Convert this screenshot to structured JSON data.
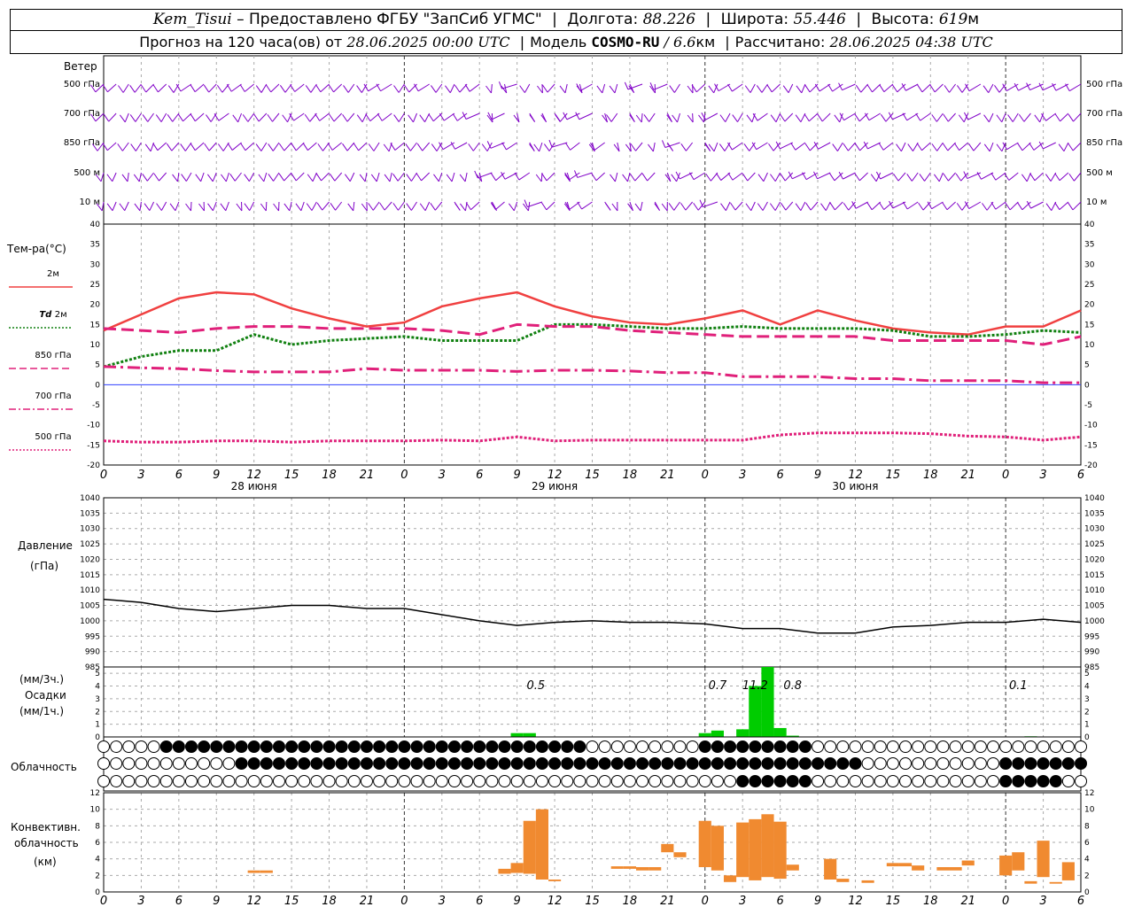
{
  "header": {
    "station": "Kem_Tisui",
    "provider": "Предоставлено ФГБУ \"ЗапСиб УГМС\"",
    "lon_label": "Долгота:",
    "lon": "88.226",
    "lat_label": "Широта:",
    "lat": "55.446",
    "alt_label": "Высота:",
    "alt": "619",
    "alt_unit": "м",
    "forecast_prefix": "Прогноз на 120 часа(ов) от",
    "forecast_start": "28.06.2025 00:00 UTC",
    "model_label": "Модель",
    "model": "COSMO-RU",
    "resolution": "6.6",
    "resolution_unit": "км",
    "computed_label": "Рассчитано:",
    "computed": "28.06.2025 04:38 UTC"
  },
  "time_axis": {
    "hours": [
      "0",
      "3",
      "6",
      "9",
      "12",
      "15",
      "18",
      "21",
      "0",
      "3",
      "6",
      "9",
      "12",
      "15",
      "18",
      "21",
      "0",
      "3",
      "6",
      "9",
      "12",
      "15",
      "18",
      "21",
      "0",
      "3",
      "6"
    ],
    "days": [
      {
        "label": "28 июня",
        "hour_index": 12
      },
      {
        "label": "29 июня",
        "hour_index": 36
      },
      {
        "label": "30 июня",
        "hour_index": 60
      }
    ]
  },
  "wind_panel": {
    "title": "Ветер",
    "levels": [
      "500 гПа",
      "700 гПа",
      "850 гПа",
      "500 м",
      "10 м"
    ],
    "color": "#8000c8"
  },
  "temp_panel": {
    "title": "Тем-ра(°С)",
    "legend": [
      {
        "label": "2м",
        "color": "#f04040",
        "style": "solid"
      },
      {
        "label_italic": "Td",
        "label": "2м",
        "color": "#108010",
        "style": "dotted"
      },
      {
        "label": "850 гПа",
        "color": "#e0207a",
        "style": "dashed"
      },
      {
        "label": "700 гПа",
        "color": "#e0207a",
        "style": "dashdot"
      },
      {
        "label": "500 гПа",
        "color": "#e0207a",
        "style": "dotted"
      }
    ],
    "ticks": [
      "40",
      "35",
      "30",
      "25",
      "20",
      "15",
      "10",
      "5",
      "0",
      "-5",
      "-10",
      "-15",
      "-20"
    ]
  },
  "pressure_panel": {
    "title1": "Давление",
    "title2": "(гПа)",
    "ticks": [
      "1040",
      "1035",
      "1030",
      "1025",
      "1020",
      "1015",
      "1010",
      "1005",
      "1000",
      "995",
      "990",
      "985"
    ]
  },
  "precip_panel": {
    "title1": "(мм/3ч.)",
    "title2": "Осадки",
    "title3": "(мм/1ч.)",
    "ticks": [
      "5",
      "4",
      "3",
      "2",
      "1",
      "0"
    ],
    "totals": [
      {
        "hour": 34.5,
        "label": "0.5"
      },
      {
        "hour": 49,
        "label": "0.7"
      },
      {
        "hour": 52,
        "label": "11.2"
      },
      {
        "hour": 55,
        "label": "0.8"
      },
      {
        "hour": 73,
        "label": "0.1"
      }
    ]
  },
  "cloud_panel": {
    "title": "Облачность"
  },
  "conv_panel": {
    "title1": "Конвективн.",
    "title2": "облачность",
    "title3": "(км)",
    "ticks": [
      "12",
      "10",
      "8",
      "6",
      "4",
      "2",
      "0"
    ]
  },
  "chart_data": [
    {
      "type": "line",
      "title": "Тем-ра(°С)",
      "xlabel": "",
      "ylabel": "Тем-ра(°С)",
      "x_hours_from_start": [
        0,
        3,
        6,
        9,
        12,
        15,
        18,
        21,
        24,
        27,
        30,
        33,
        36,
        39,
        42,
        45,
        48,
        51,
        54,
        57,
        60,
        63,
        66,
        69,
        72,
        75,
        78
      ],
      "ylim": [
        -20,
        40
      ],
      "series": [
        {
          "name": "2м",
          "color": "#f04040",
          "dash": "solid",
          "values": [
            13.5,
            17.5,
            21.5,
            23,
            22.5,
            19,
            16.5,
            14.5,
            15.5,
            19.5,
            21.5,
            23,
            19.5,
            17,
            15.5,
            15,
            16.5,
            18.5,
            15,
            18.5,
            16,
            14,
            13,
            12.5,
            14.5,
            14.5,
            18.5
          ]
        },
        {
          "name": "Td 2м",
          "color": "#108010",
          "dash": "dotted",
          "values": [
            4.5,
            7,
            8.5,
            8.5,
            12.5,
            10,
            11,
            11.5,
            12,
            11,
            11,
            11,
            15,
            15,
            14.5,
            14,
            14,
            14.5,
            14,
            14,
            14,
            13.5,
            12,
            12,
            12.5,
            13.5,
            13
          ]
        },
        {
          "name": "850 гПа",
          "color": "#e0207a",
          "dash": "dashed",
          "values": [
            14,
            13.5,
            13,
            14,
            14.5,
            14.5,
            14,
            14,
            14,
            13.5,
            12.5,
            15,
            14.5,
            14.5,
            13.5,
            13,
            12.5,
            12,
            12,
            12,
            12,
            11,
            11,
            11,
            11,
            10,
            12
          ]
        },
        {
          "name": "700 гПа",
          "color": "#e0207a",
          "dash": "dashdot",
          "values": [
            4.5,
            4.2,
            4,
            3.5,
            3.2,
            3.2,
            3.2,
            4,
            3.6,
            3.6,
            3.6,
            3.3,
            3.6,
            3.6,
            3.4,
            3,
            3,
            2,
            2,
            2,
            1.5,
            1.5,
            1,
            1,
            1,
            0.5,
            0.5
          ]
        },
        {
          "name": "500 гПа",
          "color": "#e0207a",
          "dash": "dotted",
          "values": [
            -14,
            -14.3,
            -14.3,
            -14,
            -14,
            -14.3,
            -14,
            -14,
            -14,
            -13.8,
            -14,
            -13,
            -14,
            -13.8,
            -13.8,
            -13.8,
            -13.8,
            -13.8,
            -12.5,
            -12,
            -12,
            -12,
            -12.2,
            -12.8,
            -13,
            -13.8,
            -13
          ]
        }
      ]
    },
    {
      "type": "line",
      "title": "Давление (гПа)",
      "xlabel": "",
      "ylabel": "Давление (гПа)",
      "x_hours_from_start": [
        0,
        3,
        6,
        9,
        12,
        15,
        18,
        21,
        24,
        27,
        30,
        33,
        36,
        39,
        42,
        45,
        48,
        51,
        54,
        57,
        60,
        63,
        66,
        69,
        72,
        75,
        78
      ],
      "ylim": [
        985,
        1040
      ],
      "series": [
        {
          "name": "",
          "color": "#000000",
          "dash": "solid",
          "values": [
            1007,
            1006,
            1004,
            1003,
            1004,
            1005,
            1005,
            1004,
            1004,
            1002,
            1000,
            998.5,
            999.5,
            1000,
            999.5,
            999.5,
            999,
            997.5,
            997.5,
            996,
            996,
            998,
            998.5,
            999.5,
            999.5,
            1000.5,
            999.5
          ]
        }
      ]
    },
    {
      "type": "bar",
      "title": "Осадки",
      "xlabel": "",
      "ylabel": "мм/1ч.",
      "x_hours_from_start": [
        33,
        34,
        48,
        49,
        51,
        52,
        53,
        54,
        55,
        74
      ],
      "ylim": [
        0,
        5.5
      ],
      "series": [
        {
          "name": "",
          "color": "#00cc00",
          "values": [
            0.3,
            0.3,
            0.3,
            0.5,
            0.6,
            4.0,
            5.5,
            0.7,
            0.1,
            0.05
          ]
        }
      ]
    },
    {
      "type": "bar",
      "title": "Конвективн. облачность (км)",
      "xlabel": "",
      "ylabel": "км",
      "ylim": [
        0,
        12
      ],
      "series": [
        {
          "name": "",
          "color": "#f08a30",
          "ranges_km": [
            {
              "hour": 12,
              "bottom": 2.3,
              "top": 2.6
            },
            {
              "hour": 13,
              "bottom": 2.3,
              "top": 2.6
            },
            {
              "hour": 32,
              "bottom": 2.2,
              "top": 2.8
            },
            {
              "hour": 33,
              "bottom": 2.3,
              "top": 3.5
            },
            {
              "hour": 34,
              "bottom": 2.2,
              "top": 8.6
            },
            {
              "hour": 35,
              "bottom": 1.5,
              "top": 10
            },
            {
              "hour": 36,
              "bottom": 1.3,
              "top": 1.5
            },
            {
              "hour": 41,
              "bottom": 2.8,
              "top": 3.1
            },
            {
              "hour": 42,
              "bottom": 2.8,
              "top": 3.1
            },
            {
              "hour": 43,
              "bottom": 2.6,
              "top": 3.0
            },
            {
              "hour": 44,
              "bottom": 2.6,
              "top": 3.0
            },
            {
              "hour": 45,
              "bottom": 4.8,
              "top": 5.8
            },
            {
              "hour": 46,
              "bottom": 4.2,
              "top": 4.8
            },
            {
              "hour": 48,
              "bottom": 3.0,
              "top": 8.6
            },
            {
              "hour": 49,
              "bottom": 2.6,
              "top": 8.0
            },
            {
              "hour": 50,
              "bottom": 1.2,
              "top": 2.0
            },
            {
              "hour": 51,
              "bottom": 1.8,
              "top": 8.4
            },
            {
              "hour": 52,
              "bottom": 1.4,
              "top": 8.8
            },
            {
              "hour": 53,
              "bottom": 1.8,
              "top": 9.4
            },
            {
              "hour": 54,
              "bottom": 1.6,
              "top": 8.5
            },
            {
              "hour": 55,
              "bottom": 2.6,
              "top": 3.3
            },
            {
              "hour": 58,
              "bottom": 1.5,
              "top": 4.0
            },
            {
              "hour": 59,
              "bottom": 1.2,
              "top": 1.6
            },
            {
              "hour": 61,
              "bottom": 1.1,
              "top": 1.4
            },
            {
              "hour": 63,
              "bottom": 3.1,
              "top": 3.5
            },
            {
              "hour": 64,
              "bottom": 3.1,
              "top": 3.5
            },
            {
              "hour": 65,
              "bottom": 2.6,
              "top": 3.2
            },
            {
              "hour": 67,
              "bottom": 2.6,
              "top": 3.0
            },
            {
              "hour": 68,
              "bottom": 2.6,
              "top": 3.0
            },
            {
              "hour": 69,
              "bottom": 3.2,
              "top": 3.8
            },
            {
              "hour": 72,
              "bottom": 2.0,
              "top": 4.4
            },
            {
              "hour": 73,
              "bottom": 2.6,
              "top": 4.8
            },
            {
              "hour": 74,
              "bottom": 1.0,
              "top": 1.3
            },
            {
              "hour": 75,
              "bottom": 1.8,
              "top": 6.2
            },
            {
              "hour": 76,
              "bottom": 1.0,
              "top": 1.2
            },
            {
              "hour": 77,
              "bottom": 1.4,
              "top": 3.6
            }
          ]
        }
      ]
    }
  ]
}
